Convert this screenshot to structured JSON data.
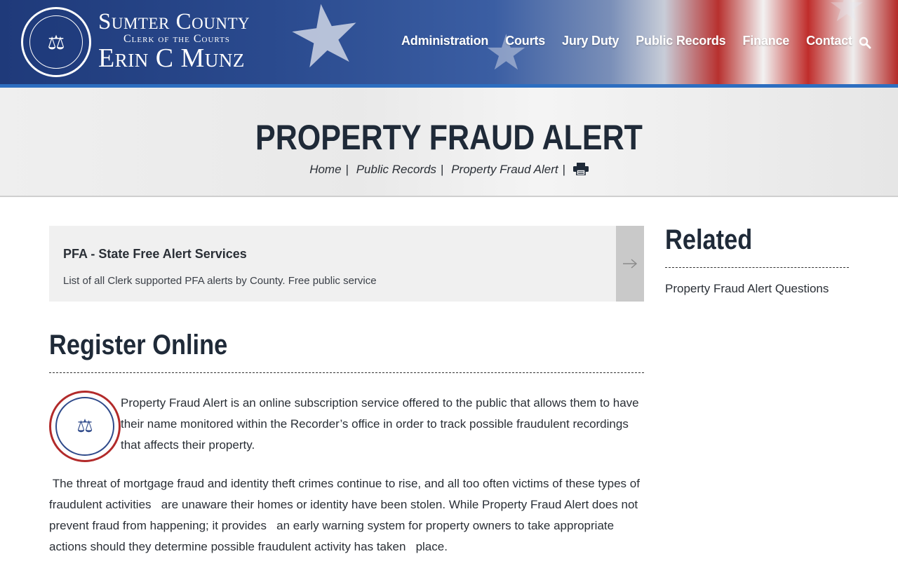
{
  "header": {
    "brand": {
      "county": "Sumter County",
      "clerk": "Clerk of the Courts",
      "name": "Erin C Munz"
    },
    "nav": [
      {
        "label": "Administration"
      },
      {
        "label": "Courts"
      },
      {
        "label": "Jury Duty"
      },
      {
        "label": "Public Records"
      },
      {
        "label": "Finance"
      },
      {
        "label": "Contact"
      }
    ],
    "search_icon": "search-icon"
  },
  "banner": {
    "title": "PROPERTY FRAUD ALERT",
    "breadcrumb": [
      "Home",
      "Public Records",
      "Property Fraud Alert"
    ],
    "print_icon": "print-icon"
  },
  "main": {
    "card": {
      "title": "PFA - State Free Alert Services",
      "description": "List of all Clerk supported PFA alerts by County. Free public service",
      "arrow_icon": "arrow-right-icon"
    },
    "section_title": "Register Online",
    "paragraph1": "Property Fraud Alert is an online subscription service offered to the public that allows them to have their name monitored within the Recorder’s office in order to track possible fraudulent recordings that affects their property.",
    "paragraph2": " The threat of mortgage fraud and identity theft crimes continue to rise, and all too often victims of these types of fraudulent activities   are unaware their homes or identity have been stolen. While Property Fraud Alert does not prevent fraud from happening; it provides   an early warning system for property owners to take appropriate actions should they determine possible fraudulent activity has taken   place."
  },
  "sidebar": {
    "title": "Related",
    "links": [
      {
        "label": "Property Fraud Alert Questions"
      }
    ]
  },
  "colors": {
    "header_blue": "#1f3a7a",
    "accent_blue": "#2d6ec0",
    "heading": "#1f2a38",
    "seal_red": "#b22a2a"
  }
}
